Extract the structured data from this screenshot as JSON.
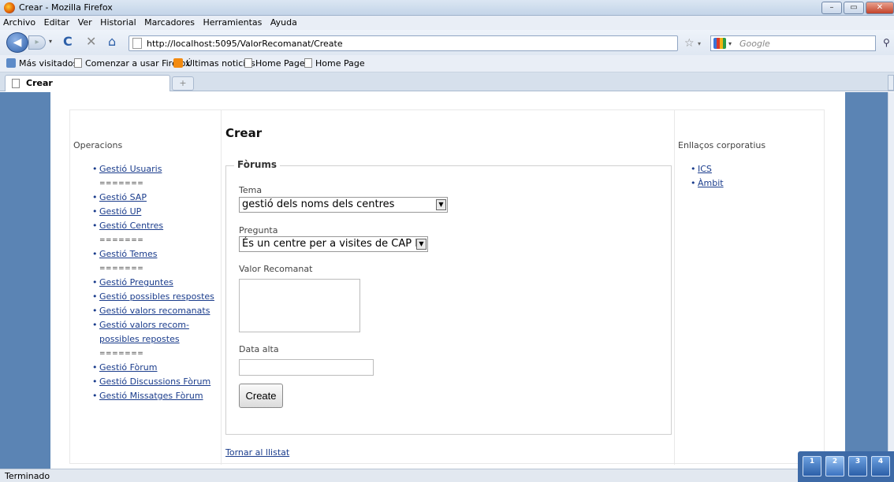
{
  "window": {
    "title": "Crear - Mozilla Firefox"
  },
  "menu": [
    "Archivo",
    "Editar",
    "Ver",
    "Historial",
    "Marcadores",
    "Herramientas",
    "Ayuda"
  ],
  "nav": {
    "url": "http://localhost:5095/ValorRecomanat/Create",
    "search_placeholder": "Google"
  },
  "bookmarks": [
    "Más visitados",
    "Comenzar a usar Firefox",
    "Últimas noticias",
    "Home Page",
    "Home Page"
  ],
  "tab": {
    "label": "Crear",
    "new_tab": "+"
  },
  "sidebar_left": {
    "heading": "Operacions",
    "items": [
      {
        "type": "link",
        "label": "Gestió Usuaris"
      },
      {
        "type": "sep",
        "label": "======="
      },
      {
        "type": "link",
        "label": "Gestió SAP"
      },
      {
        "type": "link",
        "label": "Gestió UP"
      },
      {
        "type": "link",
        "label": "Gestió Centres"
      },
      {
        "type": "sep",
        "label": "======="
      },
      {
        "type": "link",
        "label": "Gestió Temes"
      },
      {
        "type": "sep",
        "label": "======="
      },
      {
        "type": "link",
        "label": "Gestió Preguntes"
      },
      {
        "type": "link",
        "label": "Gestió possibles respostes"
      },
      {
        "type": "link",
        "label": "Gestió valors recomanats"
      },
      {
        "type": "link",
        "label": "Gestió valors recom-"
      },
      {
        "type": "link-cont",
        "label": "possibles repostes"
      },
      {
        "type": "sep",
        "label": "======="
      },
      {
        "type": "link",
        "label": "Gestió Fòrum"
      },
      {
        "type": "link",
        "label": "Gestió Discussions Fòrum"
      },
      {
        "type": "link",
        "label": "Gestió Missatges Fòrum"
      }
    ]
  },
  "sidebar_right": {
    "heading": "Enllaços corporatius",
    "items": [
      "ICS",
      "Àmbit"
    ]
  },
  "main": {
    "title": "Crear",
    "legend": "Fòrums",
    "tema_label": "Tema",
    "tema_value": "gestió dels noms dels centres",
    "pregunta_label": "Pregunta",
    "pregunta_value": "És un centre per a visites de CAP II?",
    "valor_label": "Valor Recomanat",
    "valor_value": "",
    "data_label": "Data alta",
    "data_value": "",
    "create_button": "Create",
    "back_link": "Tornar al llistat"
  },
  "status": {
    "text": "Terminado"
  },
  "desktops": [
    "1",
    "2",
    "3",
    "4"
  ]
}
